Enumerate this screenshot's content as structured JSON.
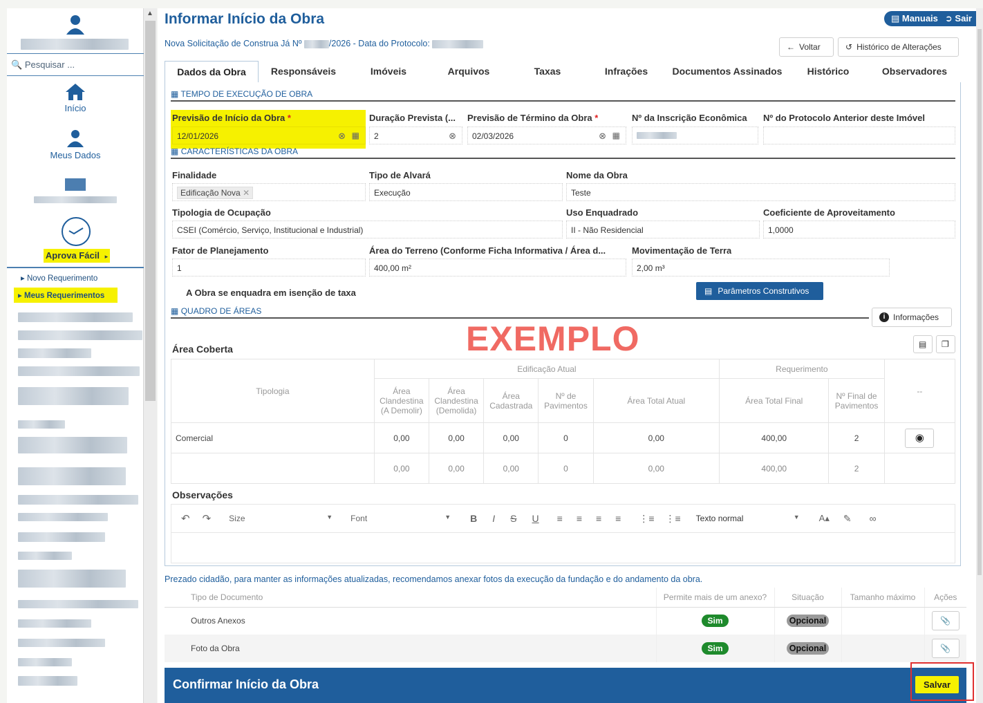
{
  "sidebar": {
    "search_placeholder": "Pesquisar ...",
    "nav": [
      {
        "label": "Início",
        "icon": "home-icon"
      },
      {
        "label": "Meus Dados",
        "icon": "user-icon"
      }
    ],
    "aprova_label": "Aprova Fácil",
    "aprova_arrow": "▸",
    "links": [
      "Novo Requerimento",
      "Meus Requerimentos"
    ]
  },
  "header": {
    "title": "Informar Início da Obra",
    "manuais": "Manuais",
    "sair": "Sair",
    "subtitle_prefix": "Nova Solicitação de Construa Já Nº",
    "subtitle_mid": "/2026 - Data do Protocolo:",
    "voltar": "Voltar",
    "historico_btn": "Histórico de Alterações"
  },
  "tabs": [
    "Dados da Obra",
    "Responsáveis",
    "Imóveis",
    "Arquivos",
    "Taxas",
    "Infrações",
    "Documentos Assinados",
    "Histórico",
    "Observadores"
  ],
  "tempo": {
    "section": "TEMPO DE EXECUÇÃO DE OBRA",
    "inicio_label": "Previsão de Início da Obra",
    "inicio_value": "12/01/2026",
    "duracao_label": "Duração Prevista (...",
    "duracao_value": "2",
    "termino_label": "Previsão de Término da Obra",
    "termino_value": "02/03/2026",
    "inscricao_label": "Nº da Inscrição Econômica",
    "protocolo_label": "Nº do Protocolo Anterior deste Imóvel",
    "required_mark": "*"
  },
  "caracteristicas": {
    "section": "CARACTERÍSTICAS DA OBRA",
    "finalidade_label": "Finalidade",
    "finalidade_value": "Edificação Nova",
    "alvara_label": "Tipo de Alvará",
    "alvara_value": "Execução",
    "nome_label": "Nome da Obra",
    "nome_value": "Teste",
    "tipologia_label": "Tipologia de Ocupação",
    "tipologia_value": "CSEI (Comércio, Serviço, Institucional e Industrial)",
    "uso_label": "Uso Enquadrado",
    "uso_value": "II - Não Residencial",
    "coef_label": "Coeficiente de Aproveitamento",
    "coef_value": "1,0000",
    "fator_label": "Fator de Planejamento",
    "fator_value": "1",
    "area_label": "Área do Terreno (Conforme Ficha Informativa / Área d...",
    "area_value": "400,00 m²",
    "mov_label": "Movimentação de Terra",
    "mov_value": "2,00 m³",
    "isencao_label": "A Obra se enquadra em isenção de taxa",
    "parametros_btn": "Parâmetros Construtivos"
  },
  "quadro": {
    "section": "QUADRO DE ÁREAS",
    "info_btn": "Informações",
    "watermark": "EXEMPLO",
    "area_coberta": "Área Coberta",
    "group_atual": "Edificação Atual",
    "group_req": "Requerimento",
    "headers": [
      "Tipologia",
      "Área Clandestina (A Demolir)",
      "Área Clandestina (Demolida)",
      "Área Cadastrada",
      "Nº de Pavimentos",
      "Área Total Atual",
      "Área Total Final",
      "Nº Final de Pavimentos",
      "--"
    ],
    "rows": [
      [
        "Comercial",
        "0,00",
        "0,00",
        "0,00",
        "0",
        "0,00",
        "400,00",
        "2"
      ],
      [
        "",
        "0,00",
        "0,00",
        "0,00",
        "0",
        "0,00",
        "400,00",
        "2"
      ]
    ]
  },
  "observacoes": {
    "label": "Observações",
    "size": "Size",
    "font": "Font",
    "style": "Texto normal"
  },
  "docs": {
    "note": "Prezado cidadão, para manter as informações atualizadas, recomendamos anexar fotos da execução da fundação e do andamento da obra.",
    "headers": [
      "Tipo de Documento",
      "Permite mais de um anexo?",
      "Situação",
      "Tamanho máximo",
      "Ações"
    ],
    "rows": [
      {
        "tipo": "Outros Anexos",
        "permite": "Sim",
        "situacao": "Opcional"
      },
      {
        "tipo": "Foto da Obra",
        "permite": "Sim",
        "situacao": "Opcional"
      }
    ]
  },
  "footer": {
    "title": "Confirmar Início da Obra",
    "salvar": "Salvar"
  },
  "colors": {
    "brand": "#1f5e9c",
    "highlight": "#f6f100",
    "success": "#1e8a2c",
    "watermark": "#f06a63"
  }
}
